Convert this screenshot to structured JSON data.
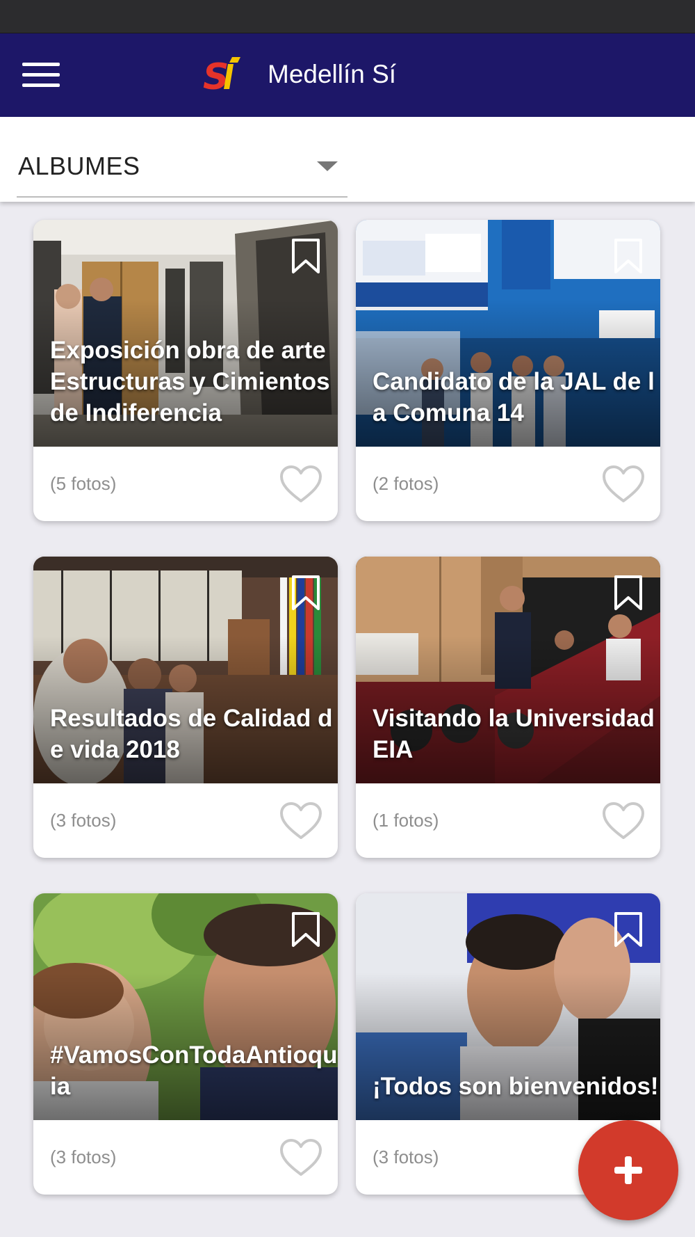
{
  "app": {
    "title": "Medellín Sí",
    "logo_text": "Sí",
    "colors": {
      "app_bar": "#1d1768",
      "fab": "#d23a2b",
      "logo_red": "#e6332a",
      "logo_yellow": "#f5c400"
    }
  },
  "filter": {
    "selected": "ALBUMES"
  },
  "albums": [
    {
      "title": "Exposición obra de arte Estructuras y Cimientos de Indiferencia",
      "count": "(5 fotos)"
    },
    {
      "title": "Candidato de la JAL de la Comuna 14",
      "count": "(2 fotos)"
    },
    {
      "title": "Resultados de Calidad de vida 2018",
      "count": "(3 fotos)"
    },
    {
      "title": "Visitando la Universidad EIA",
      "count": "(1 fotos)"
    },
    {
      "title": "#VamosConTodaAntioquia",
      "count": "(3 fotos)"
    },
    {
      "title": "¡Todos son bienvenidos!",
      "count": "(3 fotos)"
    }
  ],
  "icons": {
    "menu": "hamburger-menu-icon",
    "dropdown": "caret-down-icon",
    "bookmark": "bookmark-outline-icon",
    "like": "heart-outline-icon",
    "add": "plus-icon"
  }
}
